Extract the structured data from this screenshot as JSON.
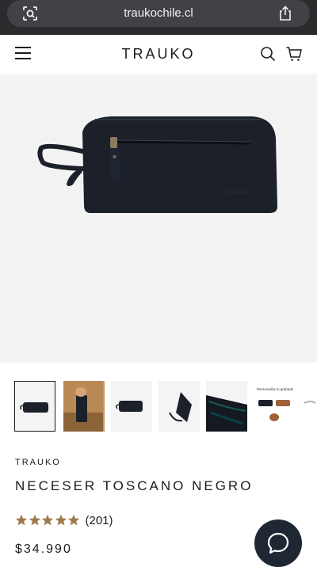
{
  "browser": {
    "url": "traukochile.cl",
    "left_icon": "page-settings-icon",
    "right_icon": "share-icon"
  },
  "header": {
    "logo": "TRAUKO",
    "menu_icon": "hamburger-menu-icon",
    "search_icon": "search-icon",
    "cart_icon": "shopping-cart-icon"
  },
  "product": {
    "vendor": "TRAUKO",
    "title": "NECESER TOSCANO NEGRO",
    "rating_stars": 5,
    "rating_count": "(201)",
    "price": "$34.990"
  },
  "gallery": {
    "thumbnail_count": 7,
    "active_index": 0,
    "thumbnail_label": "Personaliza tu grabado"
  },
  "colors": {
    "bag": "#1b2029",
    "star": "#a07a4f",
    "chat_button": "#1f2733",
    "browser_bar": "#2b2b2d"
  },
  "chat": {
    "icon": "chat-bubble-icon"
  }
}
